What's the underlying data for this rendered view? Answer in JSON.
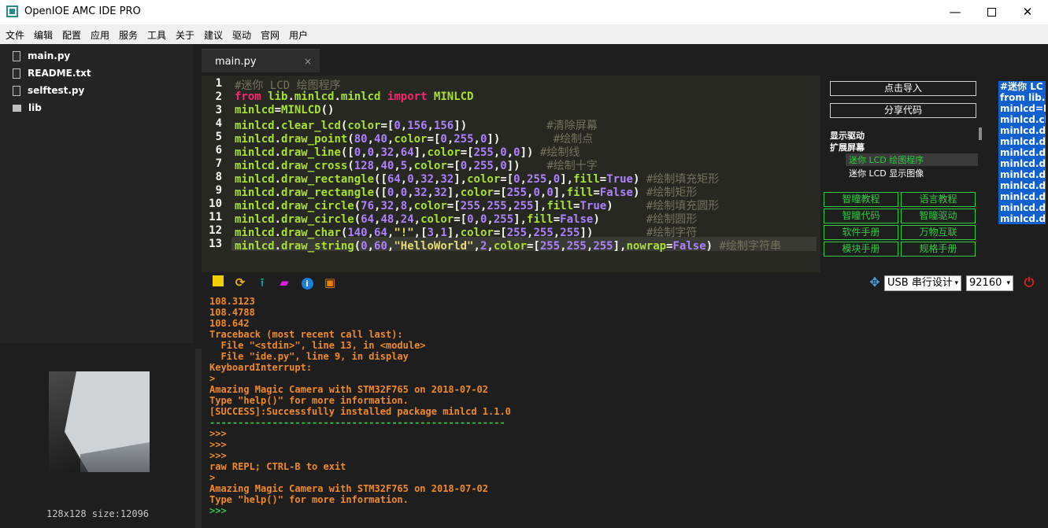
{
  "window": {
    "title": "OpenIOE AMC IDE PRO",
    "minimize": "—",
    "close": "✕"
  },
  "menu": [
    "文件",
    "编辑",
    "配置",
    "应用",
    "服务",
    "工具",
    "关于",
    "建议",
    "驱动",
    "官网",
    "用户"
  ],
  "files": [
    {
      "name": "main.py",
      "type": "file"
    },
    {
      "name": "README.txt",
      "type": "file"
    },
    {
      "name": "selftest.py",
      "type": "file"
    },
    {
      "name": "lib",
      "type": "folder"
    }
  ],
  "preview": {
    "info": "128x128 size:12096"
  },
  "editor": {
    "tab_label": "main.py",
    "tab_close": "×",
    "line_numbers": [
      "1",
      "2",
      "3",
      "4",
      "5",
      "6",
      "7",
      "8",
      "9",
      "10",
      "11",
      "12",
      "13"
    ],
    "lines": [
      "#迷你 LCD 绘图程序",
      "from lib.minlcd.minlcd import MINLCD",
      "minlcd=MINLCD()",
      "minlcd.clear_lcd(color=[0,156,156])            #清除屏幕",
      "minlcd.draw_point(80,40,color=[0,255,0])        #绘制点",
      "minlcd.draw_line([0,0,32,64],color=[255,0,0]) #绘制线",
      "minlcd.draw_cross(128,40,5,color=[0,255,0])    #绘制十字",
      "minlcd.draw_rectangle([64,0,32,32],color=[0,255,0],fill=True) #绘制填充矩形",
      "minlcd.draw_rectangle([0,0,32,32],color=[255,0,0],fill=False) #绘制矩形",
      "minlcd.draw_circle(76,32,8,color=[255,255,255],fill=True)     #绘制填充圆形",
      "minlcd.draw_circle(64,48,24,color=[0,0,255],fill=False)       #绘制圆形",
      "minlcd.draw_char(140,64,\"!\",[3,1],color=[255,255,255])        #绘制字符",
      "minlcd.draw_string(0,60,\"HelloWorld\",2,color=[255,255,255],nowrap=False) #绘制字符串"
    ]
  },
  "right_panel": {
    "import_button": "点击导入",
    "share_button": "分享代码",
    "tree_headers": [
      "显示驱动",
      "扩展屏幕"
    ],
    "tree_items": [
      "迷你 LCD 绘图程序",
      "迷你 LCD 显示图像"
    ],
    "link_buttons": [
      "智瞳教程",
      "语言教程",
      "智瞳代码",
      "智瞳驱动",
      "软件手册",
      "万物互联",
      "模块手册",
      "规格手册"
    ]
  },
  "minimap": {
    "lines": [
      "#迷你 LC",
      "from lib.m",
      "minlcd=M",
      "minlcd.cl",
      "minlcd.dr",
      "minlcd.dr",
      "minlcd.dr",
      "minlcd.dr",
      "minlcd.dr",
      "minlcd.dr",
      "minlcd.dr",
      "minlcd.dr",
      "minlcd.dr"
    ]
  },
  "console_toolbar": {
    "info_glyph": "i",
    "port": "USB 串行设计",
    "baud": "92160",
    "dropdown_glyph": "▾"
  },
  "console": {
    "lines": [
      {
        "text": "108.3123",
        "color": "orange"
      },
      {
        "text": "108.4788",
        "color": "orange"
      },
      {
        "text": "108.642",
        "color": "orange"
      },
      {
        "text": "Traceback (most recent call last):",
        "color": "orange"
      },
      {
        "text": "  File \"<stdin>\", line 13, in <module>",
        "color": "orange"
      },
      {
        "text": "  File \"ide.py\", line 9, in display",
        "color": "orange"
      },
      {
        "text": "KeyboardInterrupt:",
        "color": "orange"
      },
      {
        "text": ">",
        "color": "orange"
      },
      {
        "text": "Amazing Magic Camera with STM32F765 on 2018-07-02",
        "color": "orange"
      },
      {
        "text": "Type \"help()\" for more information.",
        "color": "orange"
      },
      {
        "text": "[SUCCESS]:Successfully installed package minlcd 1.1.0",
        "color": "orange"
      },
      {
        "text": "----------------------------------------------------",
        "color": "green"
      },
      {
        "text": ">>>",
        "color": "orange"
      },
      {
        "text": ">>>",
        "color": "orange"
      },
      {
        "text": ">>>",
        "color": "orange"
      },
      {
        "text": "raw REPL; CTRL-B to exit",
        "color": "orange"
      },
      {
        "text": ">",
        "color": "orange"
      },
      {
        "text": "Amazing Magic Camera with STM32F765 on 2018-07-02",
        "color": "orange"
      },
      {
        "text": "Type \"help()\" for more information.",
        "color": "orange"
      },
      {
        "text": ">>>",
        "color": "green"
      }
    ]
  },
  "colors": {
    "console_orange": "#f08a24",
    "console_green": "#2ecc40",
    "editor_bg": "#272822",
    "accent_green": "#2ecc40"
  }
}
